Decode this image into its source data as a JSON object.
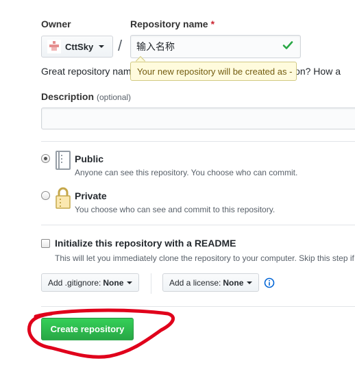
{
  "owner": {
    "label": "Owner",
    "selected": "CttSky"
  },
  "separator": "/",
  "repository_name": {
    "label": "Repository name",
    "required_mark": "*",
    "value": "输入名称",
    "valid": true
  },
  "great_text": "Great repository nam",
  "great_text_tail": "iration? How a",
  "tooltip": "Your new repository will be created as -",
  "description": {
    "label": "Description",
    "optional": "(optional)",
    "value": ""
  },
  "visibility": [
    {
      "title": "Public",
      "desc": "Anyone can see this repository. You choose who can commit.",
      "checked": true,
      "icon": "repo-book-icon"
    },
    {
      "title": "Private",
      "desc": "You choose who can see and commit to this repository.",
      "checked": false,
      "icon": "lock-icon"
    }
  ],
  "readme": {
    "title": "Initialize this repository with a README",
    "desc": "This will let you immediately clone the repository to your computer. Skip this step if",
    "checked": false
  },
  "gitignore": {
    "label": "Add .gitignore:",
    "value": "None"
  },
  "license": {
    "label": "Add a license:",
    "value": "None"
  },
  "create_button": "Create repository",
  "colors": {
    "primary_green": "#28a745",
    "annotation_red": "#e0001b",
    "tooltip_bg": "#fffbdd",
    "check_green": "#28a745",
    "info_blue": "#0366d6"
  }
}
